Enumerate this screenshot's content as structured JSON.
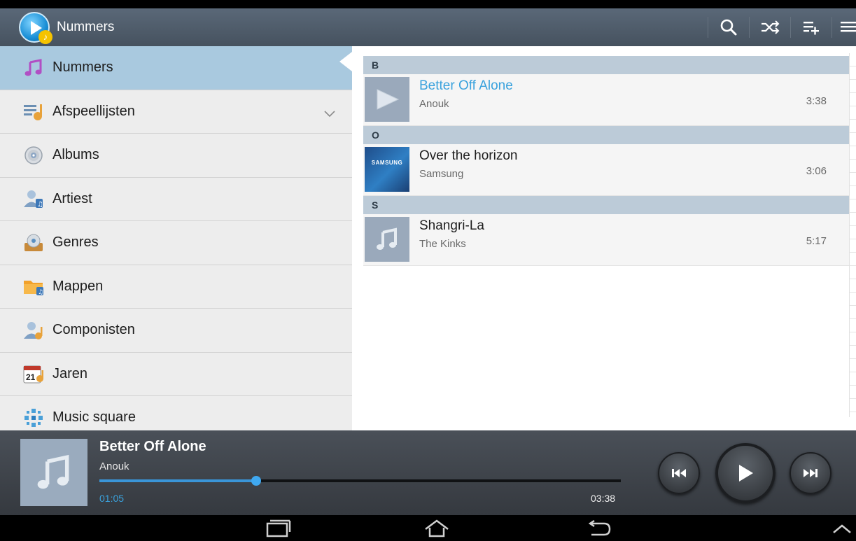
{
  "action_bar": {
    "title": "Nummers",
    "actions": [
      {
        "icon": "search-icon"
      },
      {
        "icon": "shuffle-icon"
      },
      {
        "icon": "add-to-playlist-icon"
      },
      {
        "icon": "overflow-menu-icon"
      }
    ]
  },
  "sidebar": {
    "items": [
      {
        "label": "Nummers",
        "icon": "music-note-icon",
        "active": true
      },
      {
        "label": "Afspeellijsten",
        "icon": "playlist-icon",
        "expandable": true
      },
      {
        "label": "Albums",
        "icon": "album-disc-icon"
      },
      {
        "label": "Artiest",
        "icon": "artist-icon"
      },
      {
        "label": "Genres",
        "icon": "genres-icon"
      },
      {
        "label": "Mappen",
        "icon": "folder-icon"
      },
      {
        "label": "Componisten",
        "icon": "composer-icon"
      },
      {
        "label": "Jaren",
        "icon": "calendar-icon",
        "icon_text": "21"
      },
      {
        "label": "Music square",
        "icon": "music-square-icon"
      }
    ]
  },
  "song_list": {
    "sections": [
      {
        "header": "B",
        "songs": [
          {
            "title": "Better Off Alone",
            "artist": "Anouk",
            "duration": "3:38",
            "playing": true
          }
        ]
      },
      {
        "header": "O",
        "songs": [
          {
            "title": "Over the horizon",
            "artist": "Samsung",
            "duration": "3:06",
            "thumb_text": "SAMSUNG"
          }
        ]
      },
      {
        "header": "S",
        "songs": [
          {
            "title": "Shangri-La",
            "artist": "The Kinks",
            "duration": "5:17"
          }
        ]
      }
    ]
  },
  "player": {
    "title": "Better Off Alone",
    "artist": "Anouk",
    "current_time": "01:05",
    "total_time": "03:38",
    "progress": 0.3
  },
  "colors": {
    "accent": "#3aa2dd",
    "action_bar": "#4f5b68",
    "sidebar_active": "#a9c9df",
    "section_header": "#bccbd8"
  }
}
